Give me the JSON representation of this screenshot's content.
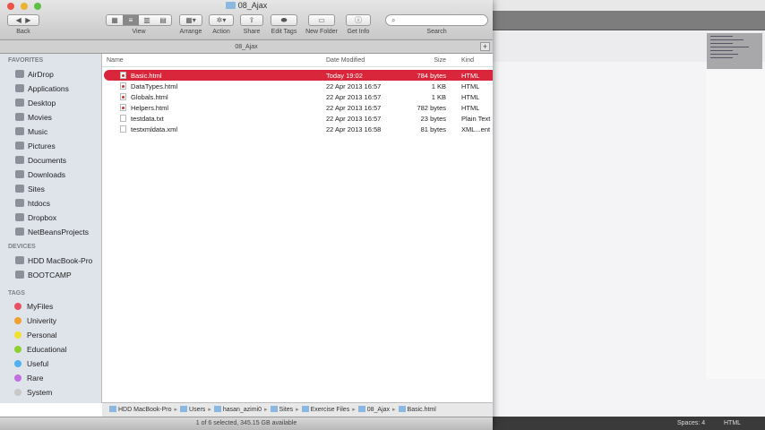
{
  "window": {
    "title": "08_Ajax",
    "path_tab": "08_Ajax"
  },
  "toolbar": {
    "back": "Back",
    "view": "View",
    "arrange": "Arrange",
    "action": "Action",
    "share": "Share",
    "edit_tags": "Edit Tags",
    "new_folder": "New Folder",
    "get_info": "Get Info",
    "search": "Search",
    "search_placeholder": ""
  },
  "sidebar": {
    "favorites_header": "FAVORITES",
    "favorites": [
      "AirDrop",
      "Applications",
      "Desktop",
      "Movies",
      "Music",
      "Pictures",
      "Documents",
      "Downloads",
      "Sites",
      "htdocs",
      "Dropbox",
      "NetBeansProjects"
    ],
    "devices_header": "DEVICES",
    "devices": [
      "HDD MacBook-Pro",
      "BOOTCAMP"
    ],
    "tags_header": "TAGS",
    "tags": [
      {
        "label": "MyFiles",
        "color": "#e8515f"
      },
      {
        "label": "Univerity",
        "color": "#f0a030"
      },
      {
        "label": "Personal",
        "color": "#f0e030"
      },
      {
        "label": "Educational",
        "color": "#8cd030"
      },
      {
        "label": "Useful",
        "color": "#50b0f0"
      },
      {
        "label": "Rare",
        "color": "#c070e0"
      },
      {
        "label": "System",
        "color": "#c8c8c8"
      }
    ]
  },
  "columns": {
    "name": "Name",
    "date": "Date Modified",
    "size": "Size",
    "kind": "Kind"
  },
  "files": [
    {
      "name": "Basic.html",
      "date": "Today 19:02",
      "size": "784 bytes",
      "kind": "HTML",
      "type": "html",
      "selected": true
    },
    {
      "name": "DataTypes.html",
      "date": "22 Apr 2013 16:57",
      "size": "1 KB",
      "kind": "HTML",
      "type": "html"
    },
    {
      "name": "Globals.html",
      "date": "22 Apr 2013 16:57",
      "size": "1 KB",
      "kind": "HTML",
      "type": "html"
    },
    {
      "name": "Helpers.html",
      "date": "22 Apr 2013 16:57",
      "size": "782 bytes",
      "kind": "HTML",
      "type": "html"
    },
    {
      "name": "testdata.txt",
      "date": "22 Apr 2013 16:57",
      "size": "23 bytes",
      "kind": "Plain Text",
      "type": "txt"
    },
    {
      "name": "testxmldata.xml",
      "date": "22 Apr 2013 16:58",
      "size": "81 bytes",
      "kind": "XML...ent",
      "type": "txt"
    }
  ],
  "pathbar": [
    "HDD MacBook-Pro",
    "Users",
    "hasan_azimi0",
    "Sites",
    "Exercise Files",
    "08_Ajax",
    "Basic.html"
  ],
  "status": "1 of 6 selected, 345.15 GB available",
  "editor_status": {
    "spaces": "Spaces: 4",
    "syntax": "HTML"
  }
}
